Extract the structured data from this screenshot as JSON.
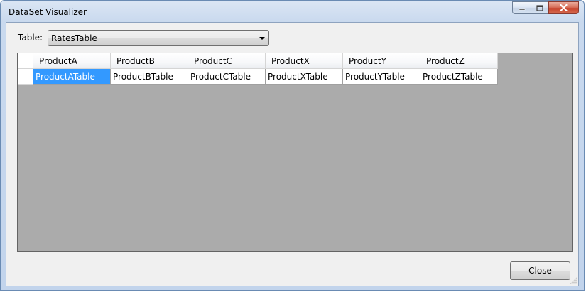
{
  "window": {
    "title": "DataSet Visualizer"
  },
  "table_selector": {
    "label": "Table:",
    "selected": "RatesTable"
  },
  "grid": {
    "columns": [
      "ProductA",
      "ProductB",
      "ProductC",
      "ProductX",
      "ProductY",
      "ProductZ"
    ],
    "rows": [
      [
        "ProductATable",
        "ProductBTable",
        "ProductCTable",
        "ProductXTable",
        "ProductYTable",
        "ProductZTable"
      ]
    ],
    "selected_cell": "0,0"
  },
  "footer": {
    "close_label": "Close"
  },
  "colors": {
    "selection": "#3399ff",
    "grid_background": "#ababab",
    "close_button_red": "#c7432c"
  },
  "icons": {
    "minimize": "minimize-icon",
    "maximize": "maximize-icon",
    "close": "close-icon",
    "dropdown": "chevron-down-icon",
    "resize": "resize-grip-icon"
  }
}
